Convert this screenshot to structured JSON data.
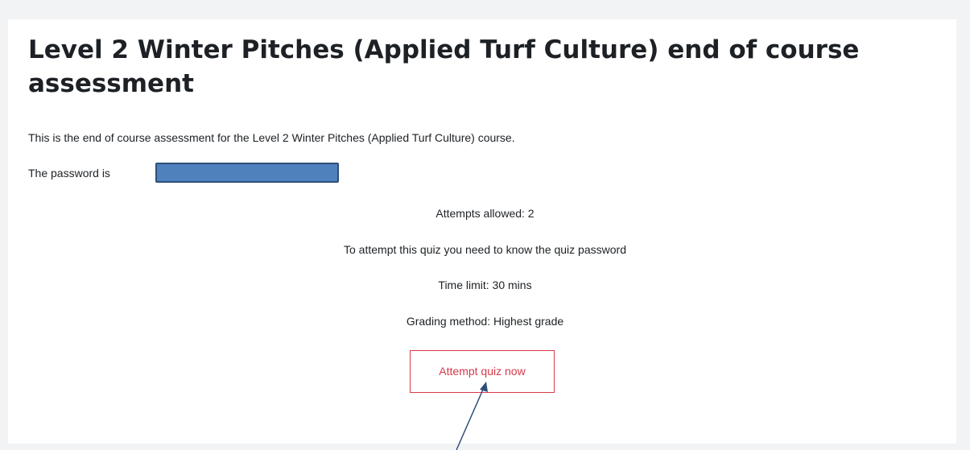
{
  "quiz": {
    "title": "Level 2 Winter Pitches (Applied Turf Culture) end of course assessment",
    "description": "This is the end of course assessment for the Level 2 Winter Pitches (Applied Turf Culture) course.",
    "password_label": "The password is"
  },
  "info": {
    "attempts_allowed": "Attempts allowed: 2",
    "password_required": "To attempt this quiz you need to know the quiz password",
    "time_limit": "Time limit: 30 mins",
    "grading_method": "Grading method: Highest grade"
  },
  "actions": {
    "attempt_label": "Attempt quiz now"
  },
  "colors": {
    "page_background": "#f2f3f5",
    "card_background": "#ffffff",
    "button_accent": "#d9394b",
    "redaction_fill": "#4f81bd",
    "annotation_arrow": "#2f4f7a"
  }
}
